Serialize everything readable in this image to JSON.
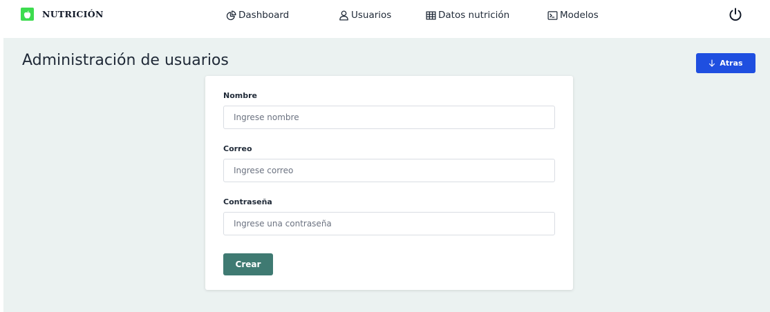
{
  "brand": {
    "name": "NUTRICIÓN",
    "logo_icon": "apple-icon",
    "logo_color": "#3ddc4f"
  },
  "nav": {
    "items": [
      {
        "label": "Dashboard",
        "icon": "pie-chart-icon"
      },
      {
        "label": "Usuarios",
        "icon": "user-icon"
      },
      {
        "label": "Datos nutrición",
        "icon": "table-icon"
      },
      {
        "label": "Modelos",
        "icon": "terminal-icon"
      }
    ],
    "logout_icon": "power-icon"
  },
  "page": {
    "title": "Administración de usuarios",
    "background": "#ebf2f1"
  },
  "back_button": {
    "label": "Atras",
    "icon": "arrow-down-icon",
    "color": "#1f4fe0"
  },
  "form": {
    "fields": [
      {
        "label": "Nombre",
        "placeholder": "Ingrese nombre",
        "value": ""
      },
      {
        "label": "Correo",
        "placeholder": "Ingrese correo",
        "value": ""
      },
      {
        "label": "Contraseña",
        "placeholder": "Ingrese una contraseña",
        "value": ""
      }
    ],
    "submit_label": "Crear",
    "submit_color": "#3f7a72"
  }
}
